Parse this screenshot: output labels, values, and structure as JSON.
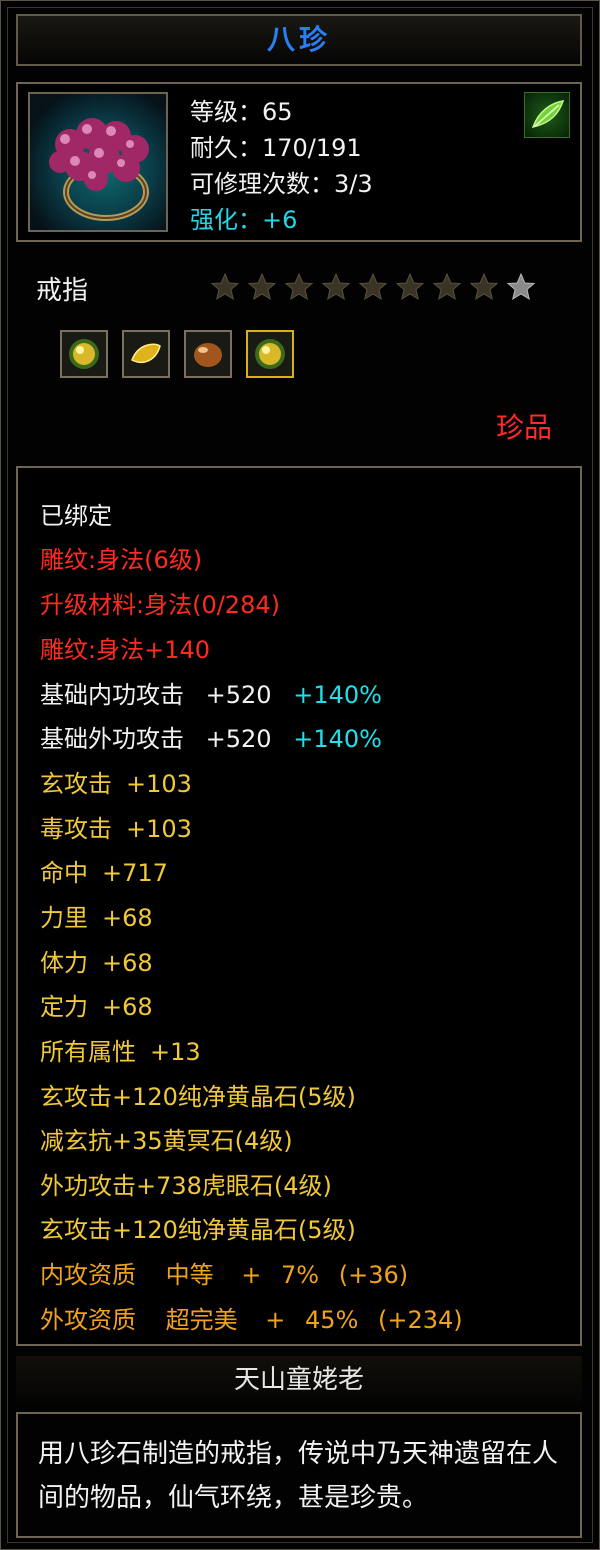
{
  "item": {
    "name": "八珍",
    "icon": "ring-with-purple-beads",
    "corner_icon": "green-leaf-icon",
    "level": "等级：65",
    "durability": "耐久：170/191",
    "repairs": "可修理次数：3/3",
    "enhance": "强化：+6",
    "type": "戒指",
    "stars": {
      "filled": 8,
      "total": 9
    },
    "gems": [
      "yellow-crystal-gem-icon",
      "gold-leaf-gem-icon",
      "bronze-egg-gem-icon",
      "yellow-crystal-gem-icon"
    ],
    "quality": "珍品"
  },
  "attributes": {
    "bound": "已绑定",
    "engrave": "雕纹:身法(6级)",
    "upgrade": "升级材料:身法(0/284)",
    "engrave_bonus": "雕纹:身法+140",
    "inner_attack": {
      "label": "基础内功攻击",
      "value": "+520",
      "pct": "+140%"
    },
    "outer_attack": {
      "label": "基础外功攻击",
      "value": "+520",
      "pct": "+140%"
    },
    "xuan_attack": {
      "label": "玄攻击",
      "value": "+103"
    },
    "poison_attack": {
      "label": "毒攻击",
      "value": "+103"
    },
    "hit": {
      "label": "命中",
      "value": "+717"
    },
    "strength": {
      "label": "力里",
      "value": "+68"
    },
    "vitality": {
      "label": "体力",
      "value": "+68"
    },
    "focus": {
      "label": "定力",
      "value": "+68"
    },
    "all_attr": {
      "label": "所有属性",
      "value": "+13"
    },
    "gem1": "玄攻击+120纯净黄晶石(5级)",
    "gem2": "减玄抗+35黄冥石(4级)",
    "gem3": "外功攻击+738虎眼石(4级)",
    "gem4": "玄攻击+120纯净黄晶石(5级)",
    "inner_quality": {
      "label": "内攻资质",
      "grade": "中等",
      "plus": "+",
      "pct": "7%",
      "bonus": "(+36)"
    },
    "outer_quality": {
      "label": "外攻资质",
      "grade": "超完美",
      "plus": "+",
      "pct": "45%",
      "bonus": "(+234)"
    }
  },
  "set_name": "天山童姥老",
  "description": "用八珍石制造的戒指，传说中乃天神遗留在人间的物品，仙气环绕，甚是珍贵。",
  "colors": {
    "title": "#2a7ef2",
    "quality": "#ff2a2a",
    "attribute": "#f0c83a",
    "engrave": "#ff2a20",
    "percent": "#22e0ea",
    "aptitude": "#f0a21e"
  }
}
